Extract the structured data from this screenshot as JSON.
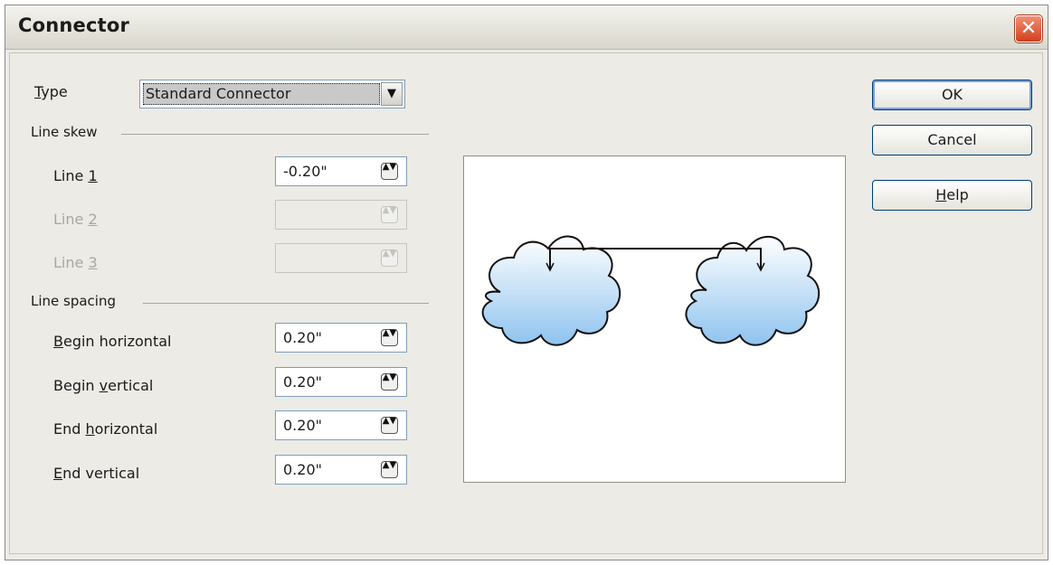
{
  "window": {
    "title": "Connector",
    "close_icon": "close-icon",
    "close_glyph": "✕"
  },
  "type": {
    "label_first": "T",
    "label_rest": "ype",
    "value": "Standard Connector",
    "arrow": "▼"
  },
  "line_skew": {
    "section_label": "Line skew",
    "fields": [
      {
        "label_prefix": "Line ",
        "label_mnemonic": "1",
        "label_suffix": "",
        "value": "-0.20\"",
        "enabled": true
      },
      {
        "label_prefix": "Line ",
        "label_mnemonic": "2",
        "label_suffix": "",
        "value": "",
        "enabled": false
      },
      {
        "label_prefix": "Line ",
        "label_mnemonic": "3",
        "label_suffix": "",
        "value": "",
        "enabled": false
      }
    ]
  },
  "line_spacing": {
    "section_label": "Line spacing",
    "fields": [
      {
        "label_prefix": "",
        "label_mnemonic": "B",
        "label_suffix": "egin horizontal",
        "value": "0.20\""
      },
      {
        "label_prefix": "Begin ",
        "label_mnemonic": "v",
        "label_suffix": "ertical",
        "value": "0.20\""
      },
      {
        "label_prefix": "End ",
        "label_mnemonic": "h",
        "label_suffix": "orizontal",
        "value": "0.20\""
      },
      {
        "label_prefix": "",
        "label_mnemonic": "E",
        "label_suffix": "nd vertical",
        "value": "0.20\""
      }
    ]
  },
  "spin_glyph": "▲▼",
  "buttons": {
    "ok": "OK",
    "cancel": "Cancel",
    "help_first": "H",
    "help_rest": "elp"
  },
  "colors": {
    "cloud_top": "#ffffff",
    "cloud_bottom": "#8ec3ef",
    "close": "#d9482a",
    "accent": "#7f9db9"
  }
}
